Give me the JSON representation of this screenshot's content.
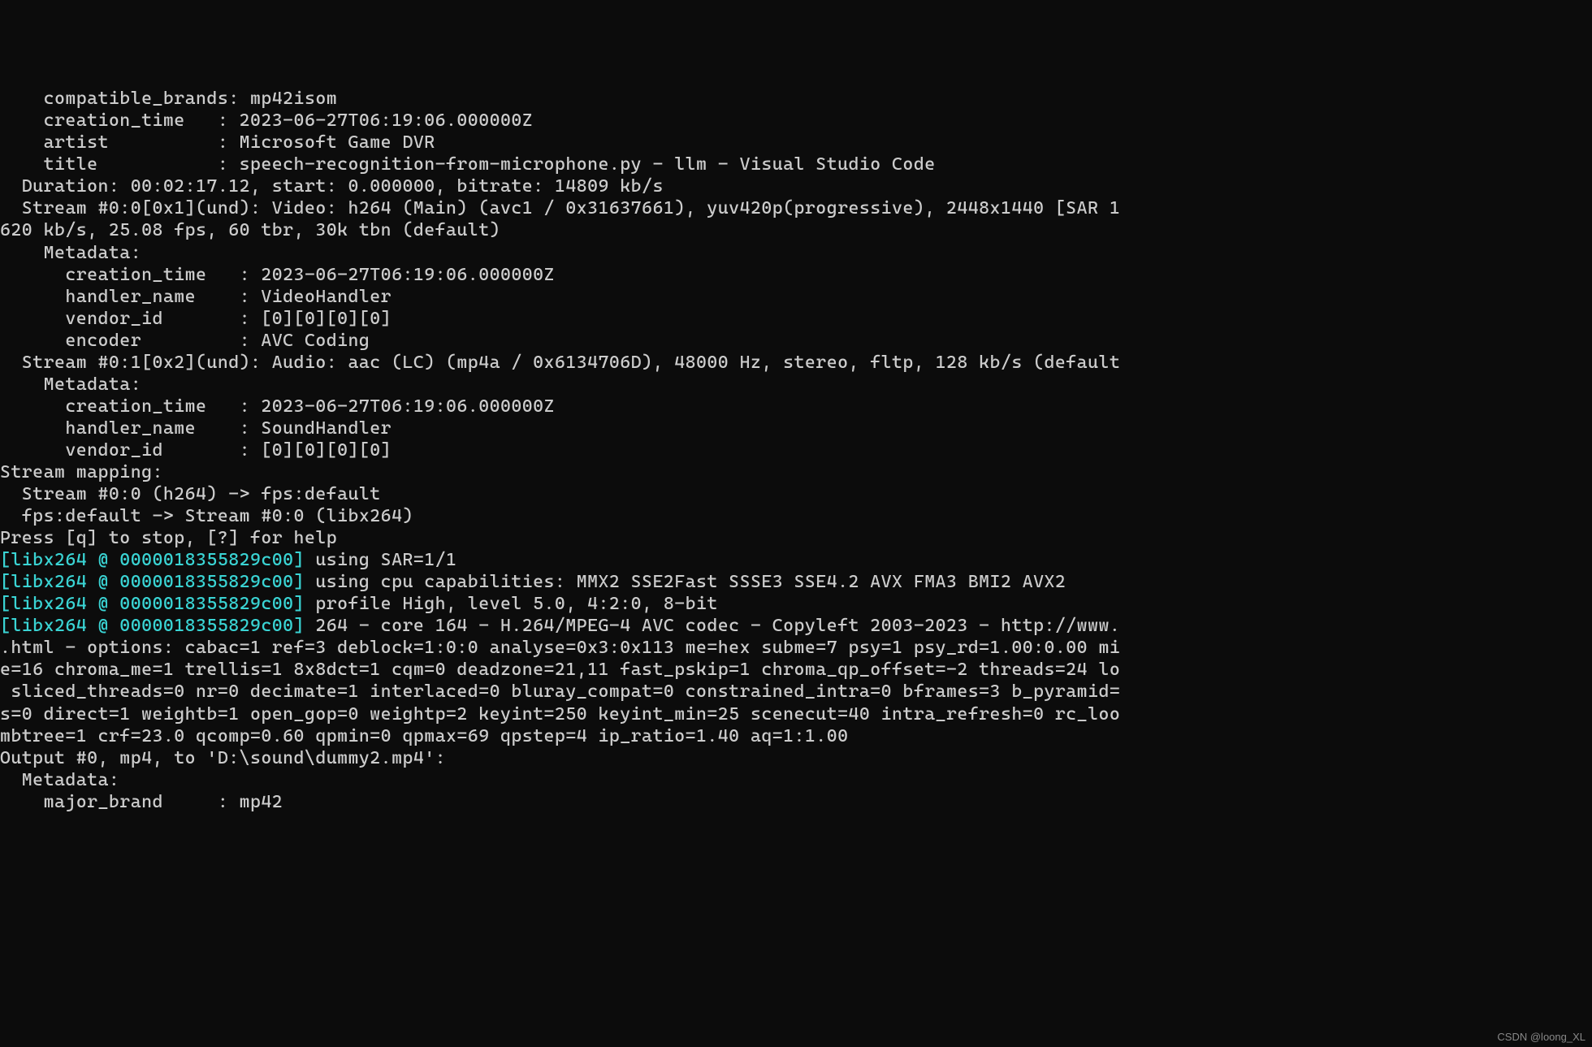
{
  "lines": {
    "l00": "    compatible_brands: mp42isom",
    "l01": "    creation_time   : 2023-06-27T06:19:06.000000Z",
    "l02": "    artist          : Microsoft Game DVR",
    "l03": "    title           : speech-recognition-from-microphone.py - llm - Visual Studio Code",
    "l04": "  Duration: 00:02:17.12, start: 0.000000, bitrate: 14809 kb/s",
    "l05": "  Stream #0:0[0x1](und): Video: h264 (Main) (avc1 / 0x31637661), yuv420p(progressive), 2448x1440 [SAR 1",
    "l06": "620 kb/s, 25.08 fps, 60 tbr, 30k tbn (default)",
    "l07": "    Metadata:",
    "l08": "      creation_time   : 2023-06-27T06:19:06.000000Z",
    "l09": "      handler_name    : VideoHandler",
    "l10": "      vendor_id       : [0][0][0][0]",
    "l11": "      encoder         : AVC Coding",
    "l12": "  Stream #0:1[0x2](und): Audio: aac (LC) (mp4a / 0x6134706D), 48000 Hz, stereo, fltp, 128 kb/s (default",
    "l13": "    Metadata:",
    "l14": "      creation_time   : 2023-06-27T06:19:06.000000Z",
    "l15": "      handler_name    : SoundHandler",
    "l16": "      vendor_id       : [0][0][0][0]",
    "l17": "Stream mapping:",
    "l18": "  Stream #0:0 (h264) -> fps:default",
    "l19": "  fps:default -> Stream #0:0 (libx264)",
    "l20": "Press [q] to stop, [?] for help",
    "l21a": "[libx264 @ 0000018355829c00]",
    "l21b": " using SAR=1/1",
    "l22a": "[libx264 @ 0000018355829c00]",
    "l22b": " using cpu capabilities: MMX2 SSE2Fast SSSE3 SSE4.2 AVX FMA3 BMI2 AVX2",
    "l23a": "[libx264 @ 0000018355829c00]",
    "l23b": " profile High, level 5.0, 4:2:0, 8-bit",
    "l24a": "[libx264 @ 0000018355829c00]",
    "l24b": " 264 - core 164 - H.264/MPEG-4 AVC codec - Copyleft 2003-2023 - http://www.",
    "l25": ".html - options: cabac=1 ref=3 deblock=1:0:0 analyse=0x3:0x113 me=hex subme=7 psy=1 psy_rd=1.00:0.00 mi",
    "l26": "e=16 chroma_me=1 trellis=1 8x8dct=1 cqm=0 deadzone=21,11 fast_pskip=1 chroma_qp_offset=-2 threads=24 lo",
    "l27": " sliced_threads=0 nr=0 decimate=1 interlaced=0 bluray_compat=0 constrained_intra=0 bframes=3 b_pyramid=",
    "l28": "s=0 direct=1 weightb=1 open_gop=0 weightp=2 keyint=250 keyint_min=25 scenecut=40 intra_refresh=0 rc_loo",
    "l29": "mbtree=1 crf=23.0 qcomp=0.60 qpmin=0 qpmax=69 qpstep=4 ip_ratio=1.40 aq=1:1.00",
    "l30": "Output #0, mp4, to 'D:\\sound\\dummy2.mp4':",
    "l31": "  Metadata:",
    "l32": "    major_brand     : mp42"
  },
  "watermark": "CSDN @loong_XL"
}
